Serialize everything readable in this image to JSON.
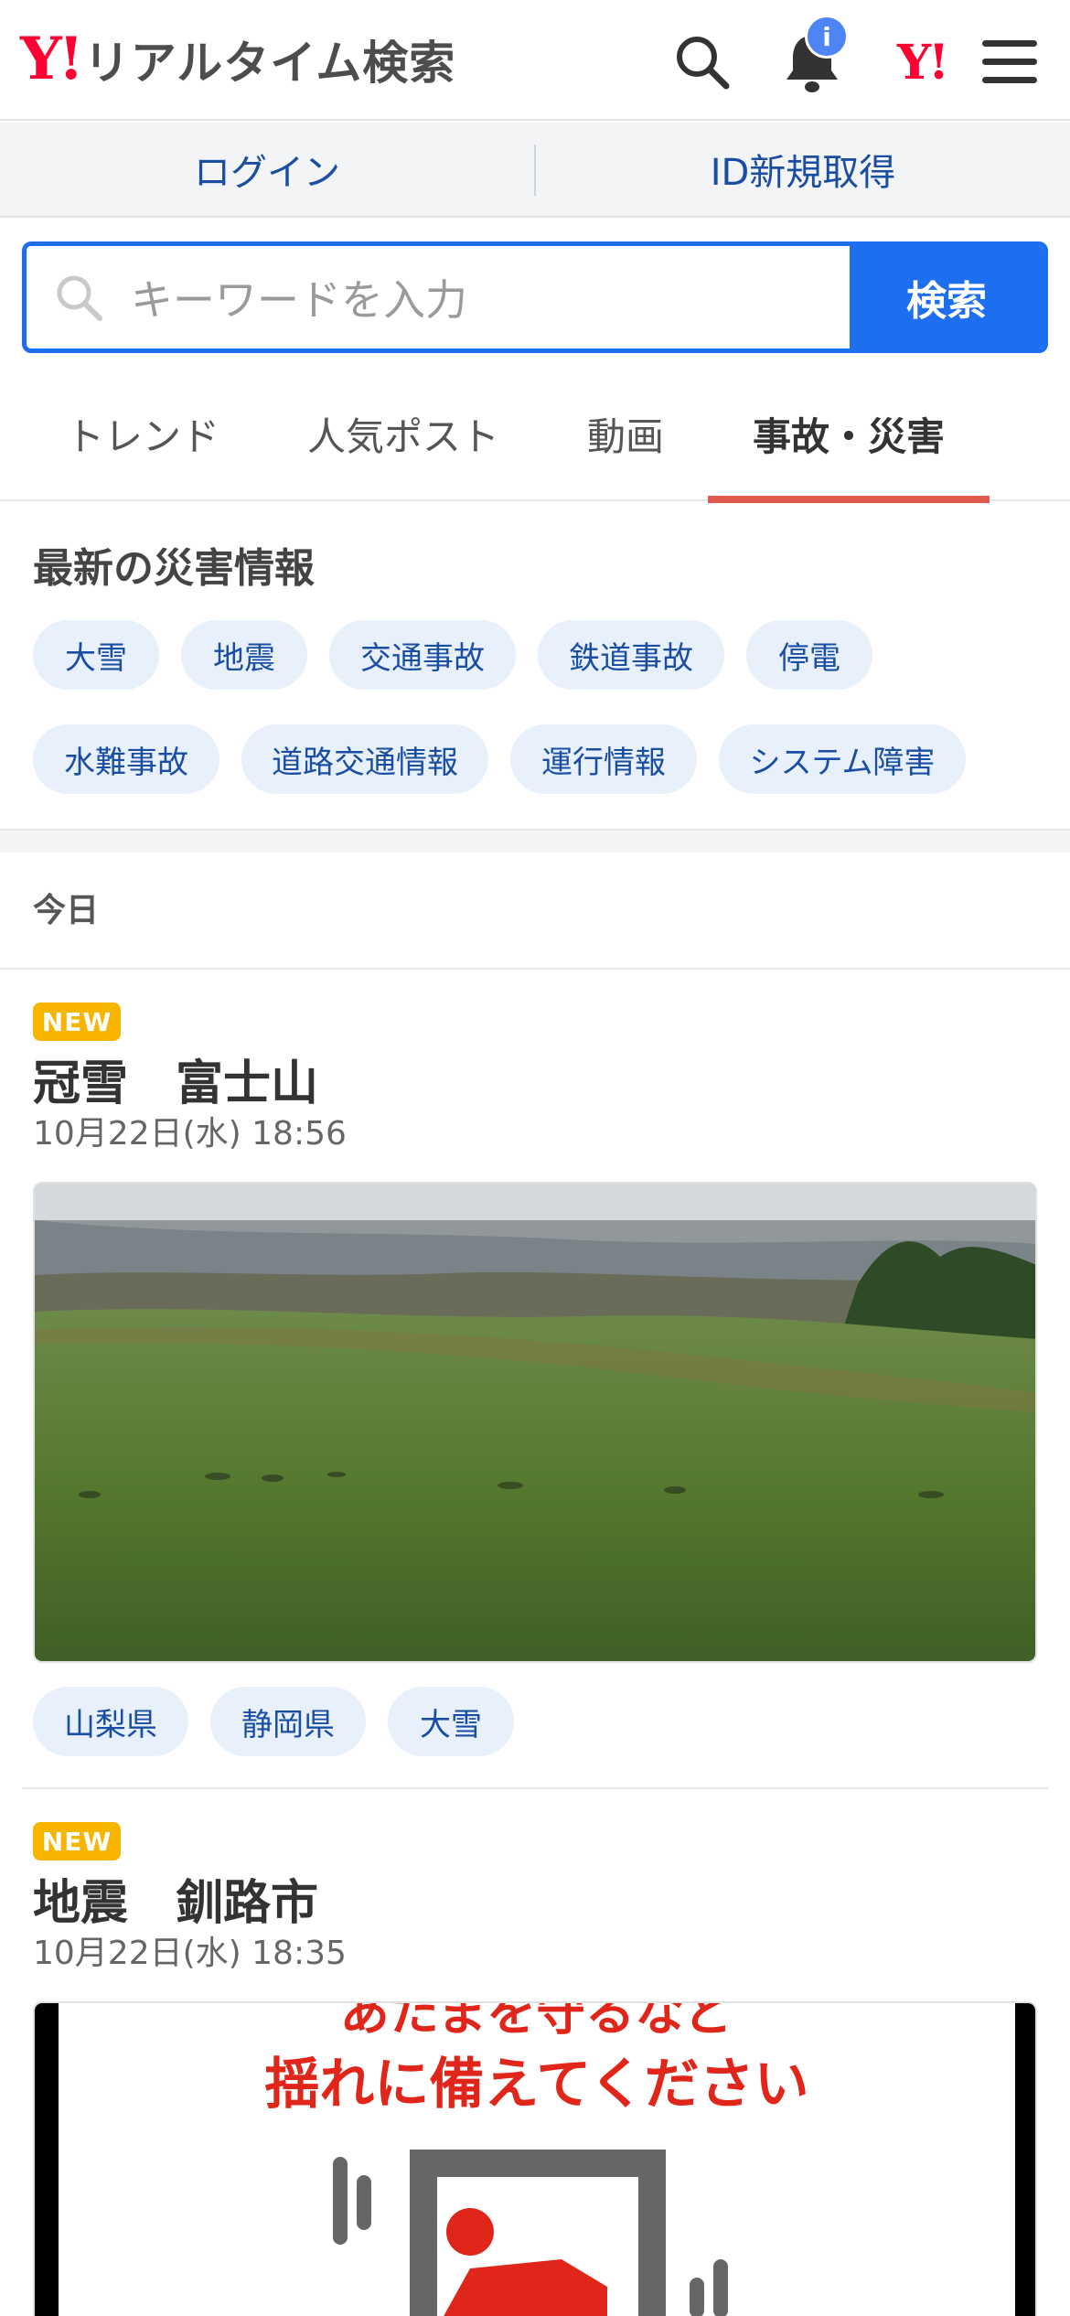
{
  "header": {
    "logo_mark": "Y!",
    "logo_text": "リアルタイム検索",
    "notification_badge": "i",
    "yahoo_mark": "Y!",
    "icons": [
      "search-icon",
      "bell-icon",
      "yahoo-logo-icon",
      "menu-icon"
    ]
  },
  "auth": {
    "login": "ログイン",
    "signup": "ID新規取得"
  },
  "search": {
    "placeholder": "キーワードを入力",
    "button": "検索"
  },
  "tabs": [
    {
      "label": "トレンド",
      "active": false
    },
    {
      "label": "人気ポスト",
      "active": false
    },
    {
      "label": "動画",
      "active": false
    },
    {
      "label": "事故・災害",
      "active": true
    }
  ],
  "disaster": {
    "title": "最新の災害情報",
    "chips": [
      "大雪",
      "地震",
      "交通事故",
      "鉄道事故",
      "停電",
      "水難事故",
      "道路交通情報",
      "運行情報",
      "システム障害"
    ]
  },
  "feed": {
    "day_label": "今日",
    "articles": [
      {
        "badge": "NEW",
        "title": "冠雪　富士山",
        "time": "10月22日(水) 18:56",
        "tags": [
          "山梨県",
          "静岡県",
          "大雪"
        ]
      },
      {
        "badge": "NEW",
        "title": "地震　釧路市",
        "time": "10月22日(水) 18:35",
        "image_text_top": "あたまを守るなど",
        "image_text": "揺れに備えてください"
      }
    ]
  },
  "colors": {
    "brand_red": "#ff0033",
    "accent_blue": "#1d6ff0",
    "link_blue": "#1a4ea2",
    "tab_underline": "#e05a4e",
    "new_badge": "#f7b500",
    "chip_bg": "#e8f0fb"
  }
}
